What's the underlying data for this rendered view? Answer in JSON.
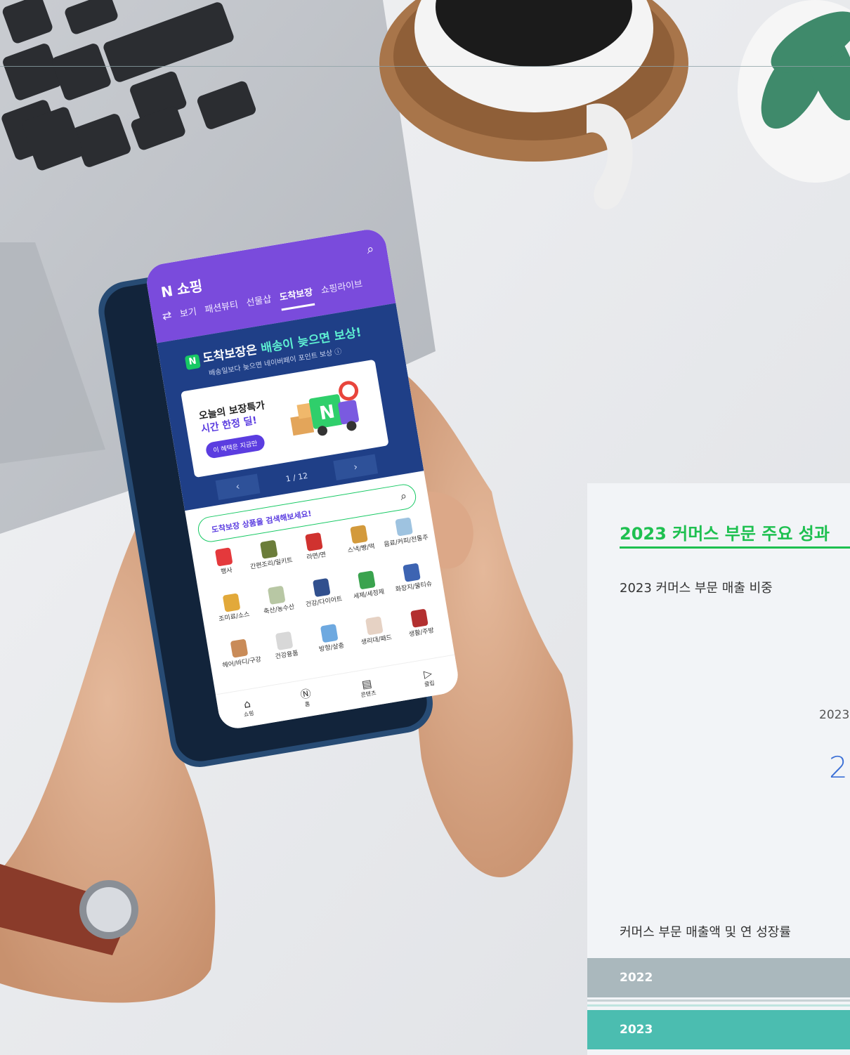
{
  "app": {
    "brand": "쇼핑",
    "tabs": [
      "보기",
      "패션뷰티",
      "선물샵",
      "도착보장",
      "쇼핑라이브"
    ],
    "active_tab": "도착보장"
  },
  "banner": {
    "title_prefix": "도착보장은",
    "title_highlight": "배송이 늦으면 보상!",
    "subtitle": "배송일보다 늦으면 네이버페이 포인트 보상 ⓘ",
    "card_line1": "오늘의 보장특가",
    "card_line2": "시간 한정 딜!",
    "card_button": "이 혜택은 지금만",
    "pager_prev": "‹",
    "pager_next": "›",
    "pager_text": "1 / 12"
  },
  "search": {
    "placeholder": "도착보장 상품을 검색해보세요!"
  },
  "categories": [
    {
      "label": "행사",
      "color": "#e4393c"
    },
    {
      "label": "간편조리/밀키트",
      "color": "#6b7d3a"
    },
    {
      "label": "라면/면",
      "color": "#d0322f"
    },
    {
      "label": "스낵/빵/떡",
      "color": "#d39a3c"
    },
    {
      "label": "음료/커피/전통주",
      "color": "#9ec3e0"
    },
    {
      "label": "조미료/소스",
      "color": "#e2a93a"
    },
    {
      "label": "축산/농수산",
      "color": "#b8c7a4"
    },
    {
      "label": "건강/다이어트",
      "color": "#31508e"
    },
    {
      "label": "세제/세정제",
      "color": "#3aa34e"
    },
    {
      "label": "화장지/물티슈",
      "color": "#3d64b2"
    },
    {
      "label": "헤어/바디/구강",
      "color": "#c98b58"
    },
    {
      "label": "건강용품",
      "color": "#d8d8d8"
    },
    {
      "label": "방향/살충",
      "color": "#6ea9e0"
    },
    {
      "label": "생리대/패드",
      "color": "#e6d2c4"
    },
    {
      "label": "생활/주방",
      "color": "#b33030"
    }
  ],
  "bottom_nav": [
    {
      "label": "쇼핑",
      "icon": "bag-icon",
      "glyph": "⌂"
    },
    {
      "label": "홈",
      "icon": "home-icon",
      "glyph": "Ⓝ"
    },
    {
      "label": "콘텐츠",
      "icon": "content-icon",
      "glyph": "▤"
    },
    {
      "label": "클립",
      "icon": "clip-icon",
      "glyph": "▷"
    }
  ],
  "panel": {
    "title": "2023 커머스 부문 주요 성과",
    "subtitle_share": "2023 커머스 부문 매출 비중",
    "chart_year": "2023",
    "chart_value": "2",
    "subtitle_sales": "커머스 부문 매출액 및 연 성장률",
    "bars": [
      {
        "label": "2022",
        "color": "#aab8bd"
      },
      {
        "label": "2023",
        "color": "#4bbdb0"
      }
    ]
  },
  "colors": {
    "accent_green": "#1ec050",
    "shopping_purple": "#7a4bdc",
    "banner_navy": "#1f3f87"
  }
}
